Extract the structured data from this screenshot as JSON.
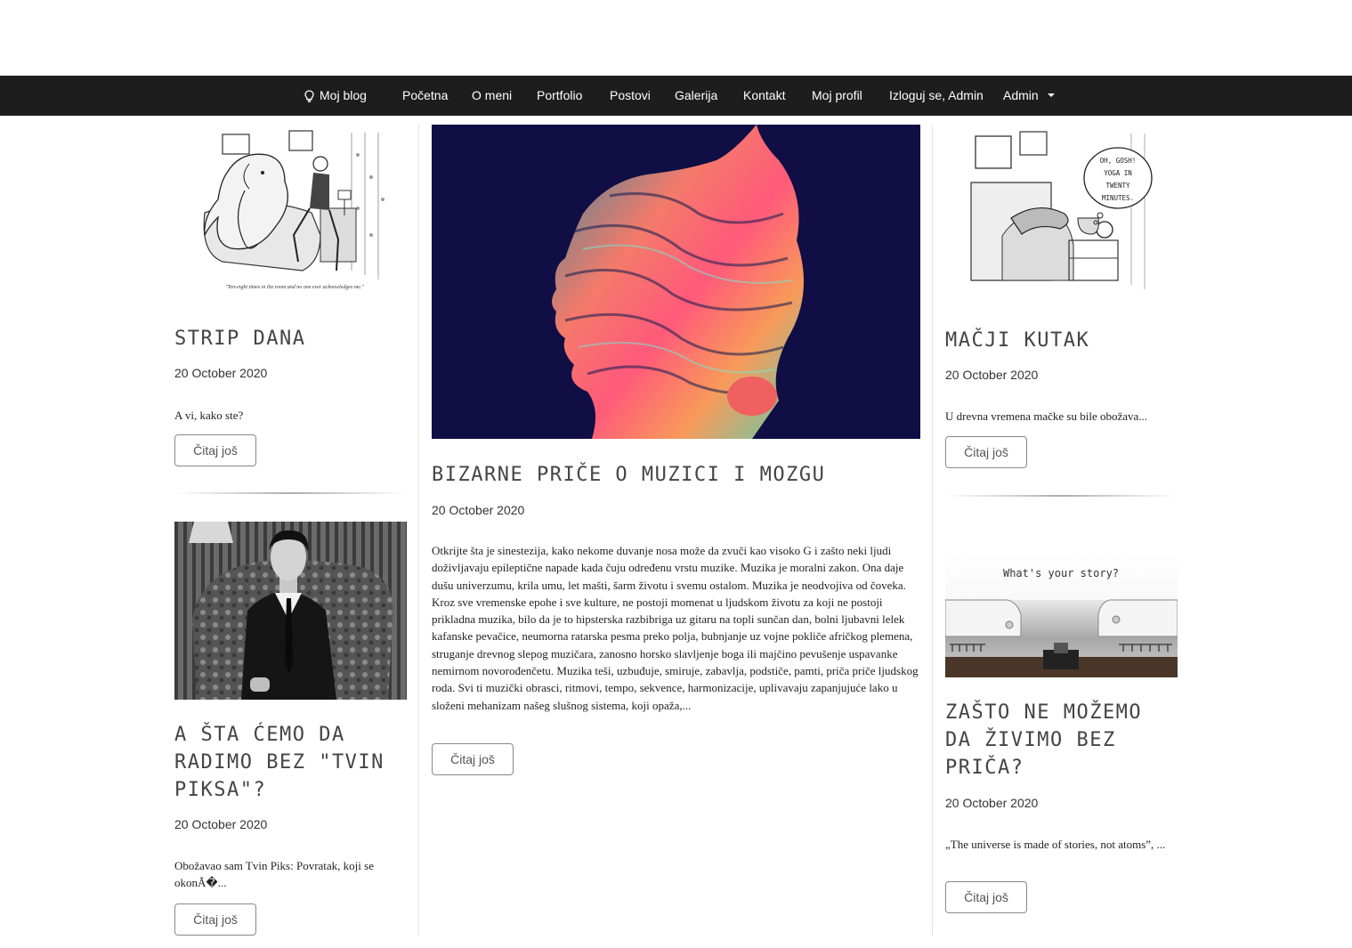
{
  "nav": {
    "brand": "Moj blog",
    "items": [
      "Početna",
      "O meni",
      "Portfolio",
      "Postovi",
      "Galerija",
      "Kontakt",
      "Moj profil",
      "Izloguj se, Admin",
      "Admin"
    ]
  },
  "posts": {
    "strip": {
      "title": "STRIP DANA",
      "date": "20 October 2020",
      "excerpt": "A vi, kako ste?",
      "caption": "\"Ten-eight times in the room and no one ever acknowledges me.\"",
      "button": "Čitaj još",
      "image_icon": "cartoon-elephant-therapy"
    },
    "twin": {
      "title": "A ŠTA ĆEMO DA RADIMO BEZ \"TVIN PIKSA\"?",
      "date": "20 October 2020",
      "excerpt": "Obožavao sam Tvin Piks: Povratak, koji se okonĂ�...",
      "button": "Čitaj još",
      "image_icon": "man-in-suit-photo"
    },
    "featured": {
      "title": "BIZARNE PRIČE O MUZICI I MOZGU",
      "date": "20 October 2020",
      "excerpt": "Otkrijte šta je sinestezija, kako nekome duvanje nosa može da zvuči kao visoko G i zašto neki ljudi doživljavaju epileptične napade kada čuju određenu vrstu muzike. Muzika je moralni zakon. Ona daje dušu univerzumu, krila umu, let mašti, šarm životu i svemu ostalom. Muzika je neodvojiva od čoveka. Kroz sve vremenske epohe i sve kulture, ne postoji momenat u ljudskom životu za koji ne postoji prikladna muzika, bilo da je to hipsterska razbibriga uz gitaru na topli sunčan dan, bolni ljubavni lelek kafanske pevačice, neumorna ratarska pesma preko polja, bubnjanje uz vojne pokliče afričkog plemena, struganje drevnog slepog muzičara, zanosno horsko slavljenje boga ili majčino pevušenje uspavanke nemirnom novorođenčetu. Muzika teši, uzbuđuje, smiruje, zabavlja, podstiče, pamti, priča priče ljudskog roda. Svi ti muzički obrasci, ritmovi, tempo, sekvence, harmonizacije, uplivavaju zapanjujuće lako u složeni mehanizam našeg slušnog sistema, koji opaža,...",
      "button": "Čitaj još",
      "image_icon": "abstract-head-profile-art"
    },
    "cat": {
      "title": "MAČJI KUTAK",
      "date": "20 October 2020",
      "excerpt": "U drevna vremena mačke su bile obožava...",
      "bubble": "OH, GOSH! YOGA IN TWENTY MINUTES.",
      "button": "Čitaj još",
      "image_icon": "cartoon-cat-yoga"
    },
    "story": {
      "title": "ZAŠTO NE MOŽEMO DA ŽIVIMO BEZ PRIČA?",
      "date": "20 October 2020",
      "excerpt": "„The universe is made of stories, not atoms”, ...",
      "typed": "What's your story?",
      "button": "Čitaj još",
      "image_icon": "typewriter-photo"
    }
  }
}
